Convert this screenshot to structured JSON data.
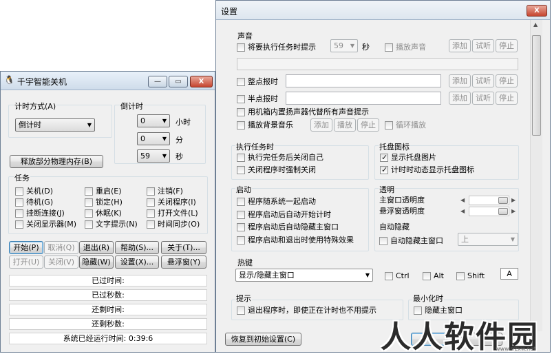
{
  "shutdown_window": {
    "title": "千宇智能关机",
    "title_buttons": {
      "minimize": "—",
      "restore": "▭",
      "close": "X"
    },
    "timing": {
      "mode_label": "计时方式(A)",
      "mode_value": "倒计时",
      "countdown_label": "倒计时",
      "hours_value": "0",
      "hours_unit": "小时",
      "minutes_value": "0",
      "minutes_unit": "分",
      "seconds_value": "59",
      "seconds_unit": "秒"
    },
    "release_memory_label": "释放部分物理内存(B)",
    "tasks": {
      "label": "任务",
      "items": [
        {
          "label": "关机(D)",
          "checked": false
        },
        {
          "label": "重启(E)",
          "checked": false
        },
        {
          "label": "注销(F)",
          "checked": false
        },
        {
          "label": "待机(G)",
          "checked": false
        },
        {
          "label": "锁定(H)",
          "checked": false
        },
        {
          "label": "关闭程序(I)",
          "checked": false
        },
        {
          "label": "挂断连接(J)",
          "checked": false
        },
        {
          "label": "休眠(K)",
          "checked": false
        },
        {
          "label": "打开文件(L)",
          "checked": false
        },
        {
          "label": "关闭显示器(M)",
          "checked": false
        },
        {
          "label": "文字提示(N)",
          "checked": false
        },
        {
          "label": "时间同步(O)",
          "checked": false
        }
      ]
    },
    "buttons": {
      "start": "开始(P)",
      "cancel": "取消(Q)",
      "exit": "退出(R)",
      "help": "帮助(S)...",
      "about": "关于(T)...",
      "open": "打开(U)",
      "close": "关闭(V)",
      "hide": "隐藏(W)",
      "settings": "设置(X)...",
      "float": "悬浮窗(Y)"
    },
    "status": {
      "elapsed_time": "已过时间:",
      "elapsed_seconds": "已过秒数:",
      "remaining_time": "还剩时间:",
      "remaining_seconds": "还剩秒数:",
      "uptime": "系统已经运行时间: 0:39:6"
    }
  },
  "settings_window": {
    "title": "设置",
    "close_glyph": "X",
    "sound": {
      "label": "声音",
      "prompt_before_task": "将要执行任务时提示",
      "prompt_seconds_value": "59",
      "seconds_unit": "秒",
      "play_sound": "播放声音",
      "add": "添加",
      "test": "试听",
      "stop": "停止",
      "hourly_chime": "整点报时",
      "half_hour_chime": "半点报时",
      "use_internal_speaker": "用机箱内置扬声器代替所有声音提示",
      "play_bg_music": "播放背景音乐",
      "play": "播放",
      "loop_play": "循环播放"
    },
    "execute_task": {
      "label": "执行任务时",
      "close_self_after": "执行完任务后关闭自己",
      "force_close_programs": "关闭程序时强制关闭"
    },
    "tray": {
      "label": "托盘图标",
      "show_tray_image": "显示托盘图片",
      "show_tray_image_checked": true,
      "animate_tray_icon": "计时时动态显示托盘图标",
      "animate_tray_icon_checked": true
    },
    "startup": {
      "label": "启动",
      "run_at_startup": "程序随系统一起启动",
      "auto_start_timing": "程序启动后自动开始计时",
      "auto_hide_main": "程序启动后自动隐藏主窗口",
      "special_effects": "程序启动和退出时使用特殊效果"
    },
    "transparency": {
      "label": "透明",
      "main_window": "主窗口透明度",
      "float_window": "悬浮窗透明度",
      "auto_hide_label": "自动隐藏",
      "auto_hide_main": "自动隐藏主窗口",
      "auto_hide_position": "上"
    },
    "hotkey": {
      "label": "热键",
      "action_value": "显示/隐藏主窗口",
      "ctrl": "Ctrl",
      "alt": "Alt",
      "shift": "Shift",
      "key": "A"
    },
    "prompt": {
      "label": "提示",
      "exit_prompt": "退出程序时，即使正在计时也不用提示"
    },
    "minimize": {
      "label": "最小化时",
      "hide_main": "隐藏主窗口"
    },
    "restore_defaults": "恢复到初始设置(C)"
  },
  "watermark": {
    "text": "人人软件园",
    "sub": "www.rrzxw.net"
  }
}
